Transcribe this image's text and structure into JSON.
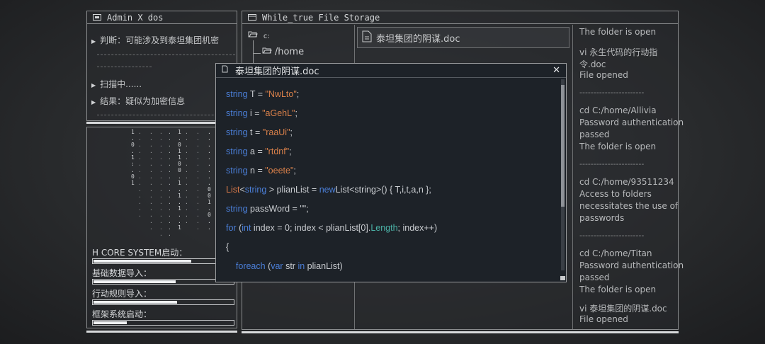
{
  "admin": {
    "title": "Admin X dos",
    "log": [
      {
        "text": "判断：可能涉及到泰坦集团机密",
        "mark": true
      },
      {
        "text": "扫描中......",
        "mark": true
      },
      {
        "text": "结果：疑似为加密信息",
        "mark": true
      }
    ],
    "status_bars": [
      {
        "label": "H CORE SYSTEM启动：",
        "progress": 0.7
      },
      {
        "label": "基础数据导入：",
        "progress": 0.59
      },
      {
        "label": "行动规则导入：",
        "progress": 0.6
      },
      {
        "label": "框架系统启动：",
        "progress": 0.24
      }
    ]
  },
  "storage": {
    "title": "While_true File Storage",
    "tree": [
      {
        "label": "c:",
        "level": 0
      },
      {
        "label": "/home",
        "level": 1
      }
    ],
    "open_file": "泰坦集团的阴谋.doc",
    "right_log": [
      "The folder is open",
      "vi 永生代码的行动指",
      "令.doc",
      "File opened",
      "-----------------------",
      "cd C:/home/Allivia",
      "Password authentication",
      "passed",
      "The folder is open",
      "-----------------------",
      "cd C:/home/93511234",
      "Access to folders",
      "necessitates the use of",
      "passwords",
      "-----------------------",
      "cd C:/home/Titan",
      "Password authentication",
      "passed",
      "The folder is open",
      "vi 泰坦集团的阴谋.doc",
      "File opened"
    ]
  },
  "editor": {
    "title": "泰坦集团的阴谋.doc",
    "close_label": "✕",
    "code": [
      [
        [
          "kw",
          "string"
        ],
        [
          "",
          "T = "
        ],
        [
          "str",
          "\"NwLto\""
        ],
        [
          "",
          ";"
        ]
      ],
      [
        [
          "kw",
          "string"
        ],
        [
          "",
          "i = "
        ],
        [
          "str",
          "\"aGehL\""
        ],
        [
          "",
          ";"
        ]
      ],
      [
        [
          "kw",
          "string"
        ],
        [
          "",
          "t = "
        ],
        [
          "str",
          "\"raaUi\""
        ],
        [
          "",
          ";"
        ]
      ],
      [
        [
          "kw",
          "string"
        ],
        [
          "",
          "a = "
        ],
        [
          "str",
          "\"rtdnf\""
        ],
        [
          "",
          ";"
        ]
      ],
      [
        [
          "kw",
          "string"
        ],
        [
          "",
          "n = "
        ],
        [
          "str",
          "\"oeete\""
        ],
        [
          "",
          ";"
        ]
      ],
      [
        [
          "typ",
          "List"
        ],
        [
          "",
          "<"
        ],
        [
          "kw",
          "string"
        ],
        [
          "",
          "> plianList = "
        ],
        [
          "kw",
          "new"
        ],
        [
          "",
          ""
        ],
        [
          "",
          "List<string>() { T,i,t,a,n };"
        ]
      ],
      [
        [
          "kw",
          "string"
        ],
        [
          "",
          "passWord = \"\";"
        ]
      ],
      [
        [
          "kw",
          "for"
        ],
        [
          "",
          " ("
        ],
        [
          "kw",
          "int"
        ],
        [
          "",
          " index = 0; index < plianList[0]."
        ],
        [
          "fld",
          "Length"
        ],
        [
          "",
          "; index++)"
        ]
      ],
      [
        [
          "",
          "{"
        ]
      ],
      [
        [
          "",
          ""
        ],
        [
          "kw",
          "    foreach"
        ],
        [
          "",
          " ("
        ],
        [
          "kw",
          "var"
        ],
        [
          "",
          " str "
        ],
        [
          "kw",
          "in"
        ],
        [
          "",
          " plianList)"
        ]
      ]
    ]
  },
  "matrix_digits": "0 1 0 1 1 0 0 1 0 1"
}
